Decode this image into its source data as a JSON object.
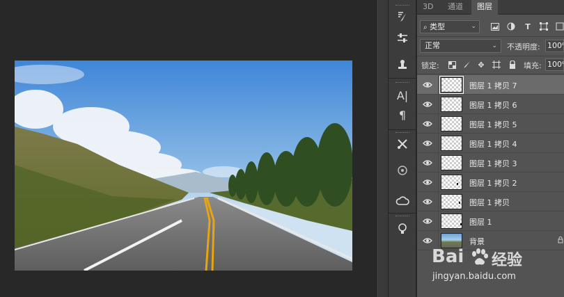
{
  "tabs": [
    "3D",
    "通道",
    "图层"
  ],
  "active_tab": 2,
  "filter": {
    "label": "类型",
    "icons": [
      "image-filter-icon",
      "adjustment-filter-icon",
      "type-filter-icon",
      "shape-filter-icon",
      "smart-object-filter-icon"
    ]
  },
  "blend": {
    "mode": "正常",
    "opacity_label": "不透明度:",
    "opacity_value": "100%"
  },
  "lock": {
    "label": "锁定:",
    "fill_label": "填充:",
    "fill_value": "100%"
  },
  "layers": [
    {
      "name": "图层 1 拷贝 7",
      "selected": true
    },
    {
      "name": "图层 1 拷贝 6",
      "selected": false
    },
    {
      "name": "图层 1 拷贝 5",
      "selected": false
    },
    {
      "name": "图层 1 拷贝 4",
      "selected": false
    },
    {
      "name": "图层 1 拷贝 3",
      "selected": false
    },
    {
      "name": "图层 1 拷贝 2",
      "selected": false
    },
    {
      "name": "图层 1 拷贝",
      "selected": false
    },
    {
      "name": "图层 1",
      "selected": false
    },
    {
      "name": "背景",
      "selected": false
    }
  ],
  "watermark": {
    "brand_left": "Bai",
    "brand_right": "经验",
    "url": "jingyan.baidu.com"
  },
  "colors": {
    "panel_bg": "#535353",
    "selected_row": "#6b6b6b",
    "workspace_bg": "#282828"
  }
}
